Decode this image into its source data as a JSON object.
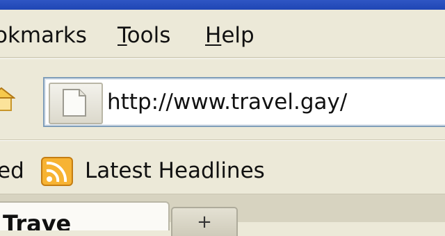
{
  "menu": {
    "bookmarks": "okmarks",
    "tools_mnemonic": "T",
    "tools_rest": "ools",
    "help_mnemonic": "H",
    "help_rest": "elp"
  },
  "navigation": {
    "url": "http://www.travel.gay/"
  },
  "bookmarks_toolbar": {
    "left_fragment": "ed",
    "latest_headlines": "Latest Headlines"
  },
  "tabs": {
    "active_label": "Trave",
    "new_tab_label": "+"
  },
  "colors": {
    "titlebar": "#2f56c4",
    "chrome": "#ece9d8",
    "rss": "#f4a524"
  }
}
